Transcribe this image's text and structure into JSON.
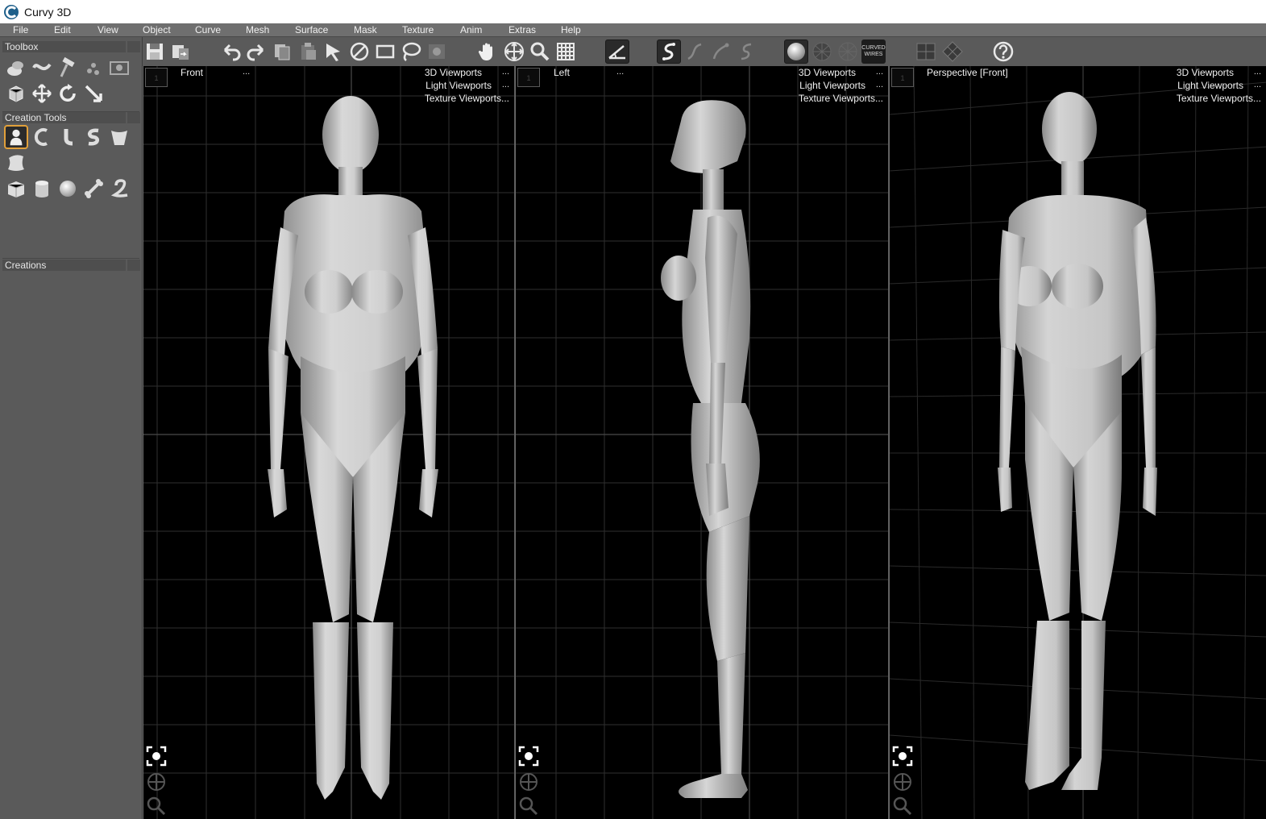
{
  "app": {
    "title": "Curvy 3D"
  },
  "menu": [
    "File",
    "Edit",
    "View",
    "Object",
    "Curve",
    "Mesh",
    "Surface",
    "Mask",
    "Texture",
    "Anim",
    "Extras",
    "Help"
  ],
  "toolbar": {
    "curved_wires_line1": "CURVED",
    "curved_wires_line2": "WIRES"
  },
  "panels": {
    "toolbox": "Toolbox",
    "creation_tools": "Creation Tools",
    "creations": "Creations"
  },
  "viewports": [
    {
      "title": "Front",
      "dots": "...",
      "num": "1",
      "links": [
        "3D Viewports",
        "Light Viewports",
        "Texture Viewports..."
      ],
      "link_dots": "..."
    },
    {
      "title": "Left",
      "dots": "...",
      "num": "1",
      "links": [
        "3D Viewports",
        "Light Viewports",
        "Texture Viewports..."
      ],
      "link_dots": "..."
    },
    {
      "title": "Perspective [Front]",
      "dots": "",
      "num": "1",
      "links": [
        "3D Viewports",
        "Light Viewports",
        "Texture Viewports..."
      ],
      "link_dots": "..."
    }
  ],
  "colors": {
    "accent_selected": "#e1a03a",
    "viewport_bg": "#000000",
    "panel_bg": "#5a5a5a",
    "grid": "#3a3a3a"
  }
}
